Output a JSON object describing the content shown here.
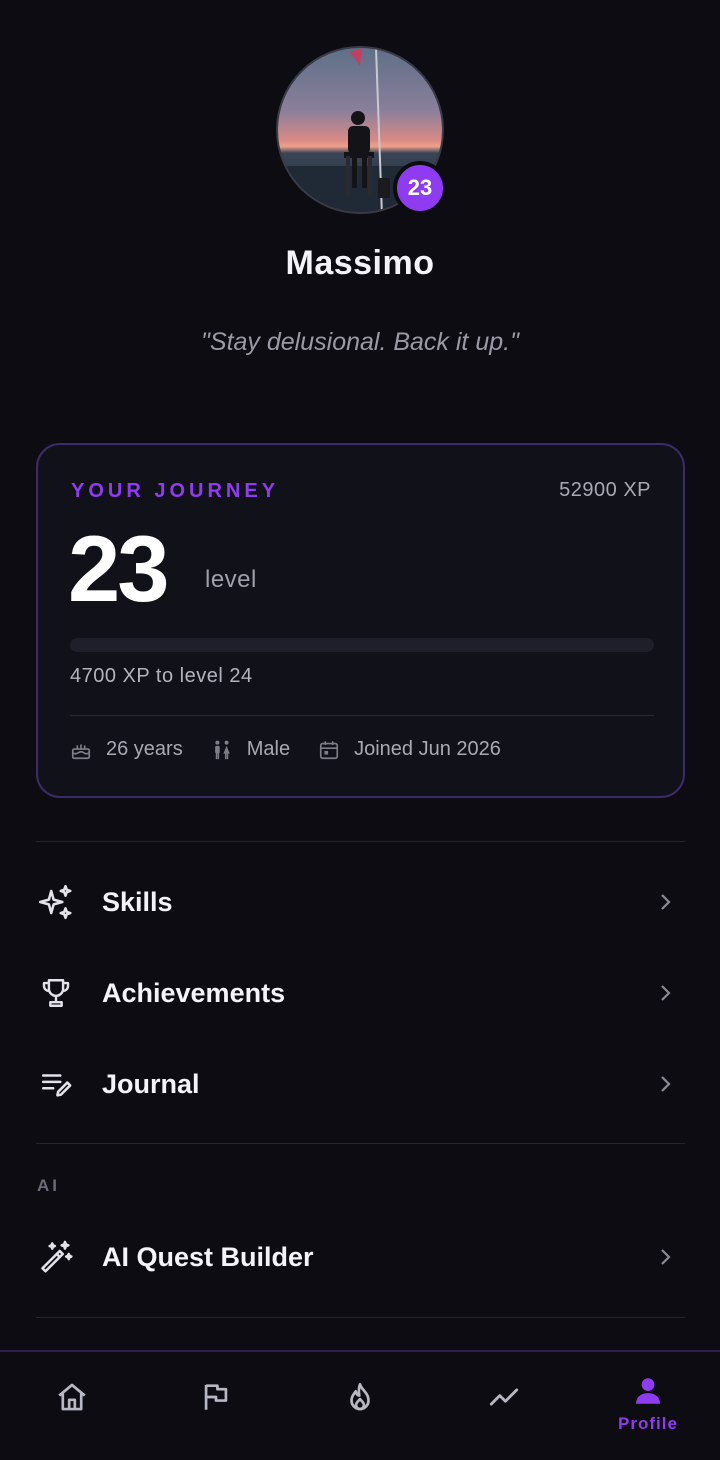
{
  "profile": {
    "name": "Massimo",
    "level_badge": "23",
    "motto": "\"Stay delusional. Back it up.\""
  },
  "journey": {
    "label": "YOUR JOURNEY",
    "total_xp": "52900 XP",
    "level": "23",
    "level_word": "level",
    "progress_fraction": 0.0,
    "next_level_text": "4700 XP to level 24",
    "age": "26 years",
    "gender": "Male",
    "joined": "Joined Jun 2026"
  },
  "menu": {
    "skills": "Skills",
    "achievements": "Achievements",
    "journal": "Journal",
    "ai_section": "AI",
    "ai_quest_builder": "AI Quest Builder"
  },
  "nav": {
    "items": [
      "home-icon",
      "flag-icon",
      "flame-icon",
      "trend-icon",
      "user-icon"
    ],
    "active_label": "Profile"
  },
  "colors": {
    "accent": "#8f3cf0",
    "background": "#0c0c12",
    "card_border": "#3d2a6a"
  }
}
